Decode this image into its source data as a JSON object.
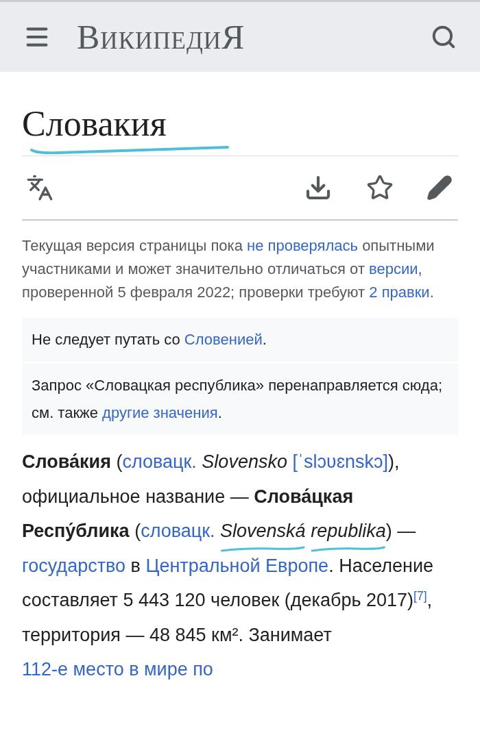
{
  "header": {
    "logo": "ВикипедиЯ"
  },
  "article": {
    "title": "Словакия",
    "title_underlined": true
  },
  "notice": [
    {
      "kind": "text",
      "text": "Текущая версия страницы пока "
    },
    {
      "kind": "link",
      "text": "не проверялась"
    },
    {
      "kind": "text",
      "text": " опытными участниками и может значительно отличаться от "
    },
    {
      "kind": "link",
      "text": "версии"
    },
    {
      "kind": "text",
      "text": ", проверенной 5 февраля 2022; проверки требуют "
    },
    {
      "kind": "link",
      "text": "2 правки"
    },
    {
      "kind": "text",
      "text": "."
    }
  ],
  "hatnotes": [
    [
      {
        "kind": "text",
        "text": "Не следует путать со "
      },
      {
        "kind": "link",
        "text": "Словенией"
      },
      {
        "kind": "text",
        "text": "."
      }
    ],
    [
      {
        "kind": "text",
        "text": "Запрос «Словацкая республика» перенаправляется сюда; см. также "
      },
      {
        "kind": "link",
        "text": "другие"
      },
      {
        "kind": "link",
        "text": "значения"
      },
      {
        "kind": "text",
        "text": "."
      }
    ]
  ],
  "paragraph": [
    {
      "kind": "bold",
      "text": "Слова́кия"
    },
    {
      "kind": "text",
      "text": " ("
    },
    {
      "kind": "link",
      "text": "словацк."
    },
    {
      "kind": "italic",
      "text": "Slovensko"
    },
    {
      "kind": "link",
      "text": "[ˈslɔʋɛnskɔ]"
    },
    {
      "kind": "text",
      "text": "), официальное название — "
    },
    {
      "kind": "bold",
      "text": "Слова́цкая Респу́блика"
    },
    {
      "kind": "text",
      "text": " ("
    },
    {
      "kind": "link",
      "text": "словацк."
    },
    {
      "kind": "italic",
      "text": "Slovenská",
      "underlined": true
    },
    {
      "kind": "italic",
      "text": "republika",
      "underlined": true
    },
    {
      "kind": "text",
      "text": ") — "
    },
    {
      "kind": "link",
      "text": "государство"
    },
    {
      "kind": "text",
      "text": " в "
    },
    {
      "kind": "link",
      "text": "Центральной"
    },
    {
      "kind": "link",
      "text": "Европе"
    },
    {
      "kind": "text",
      "text": ". Население составляет 5 443 120 человек (декабрь 2017)"
    },
    {
      "kind": "sup",
      "text": "[7]"
    },
    {
      "kind": "text",
      "text": ", территория — 48 845 км². Занимает "
    },
    {
      "kind": "link",
      "text": "112-е место в мире по"
    }
  ]
}
